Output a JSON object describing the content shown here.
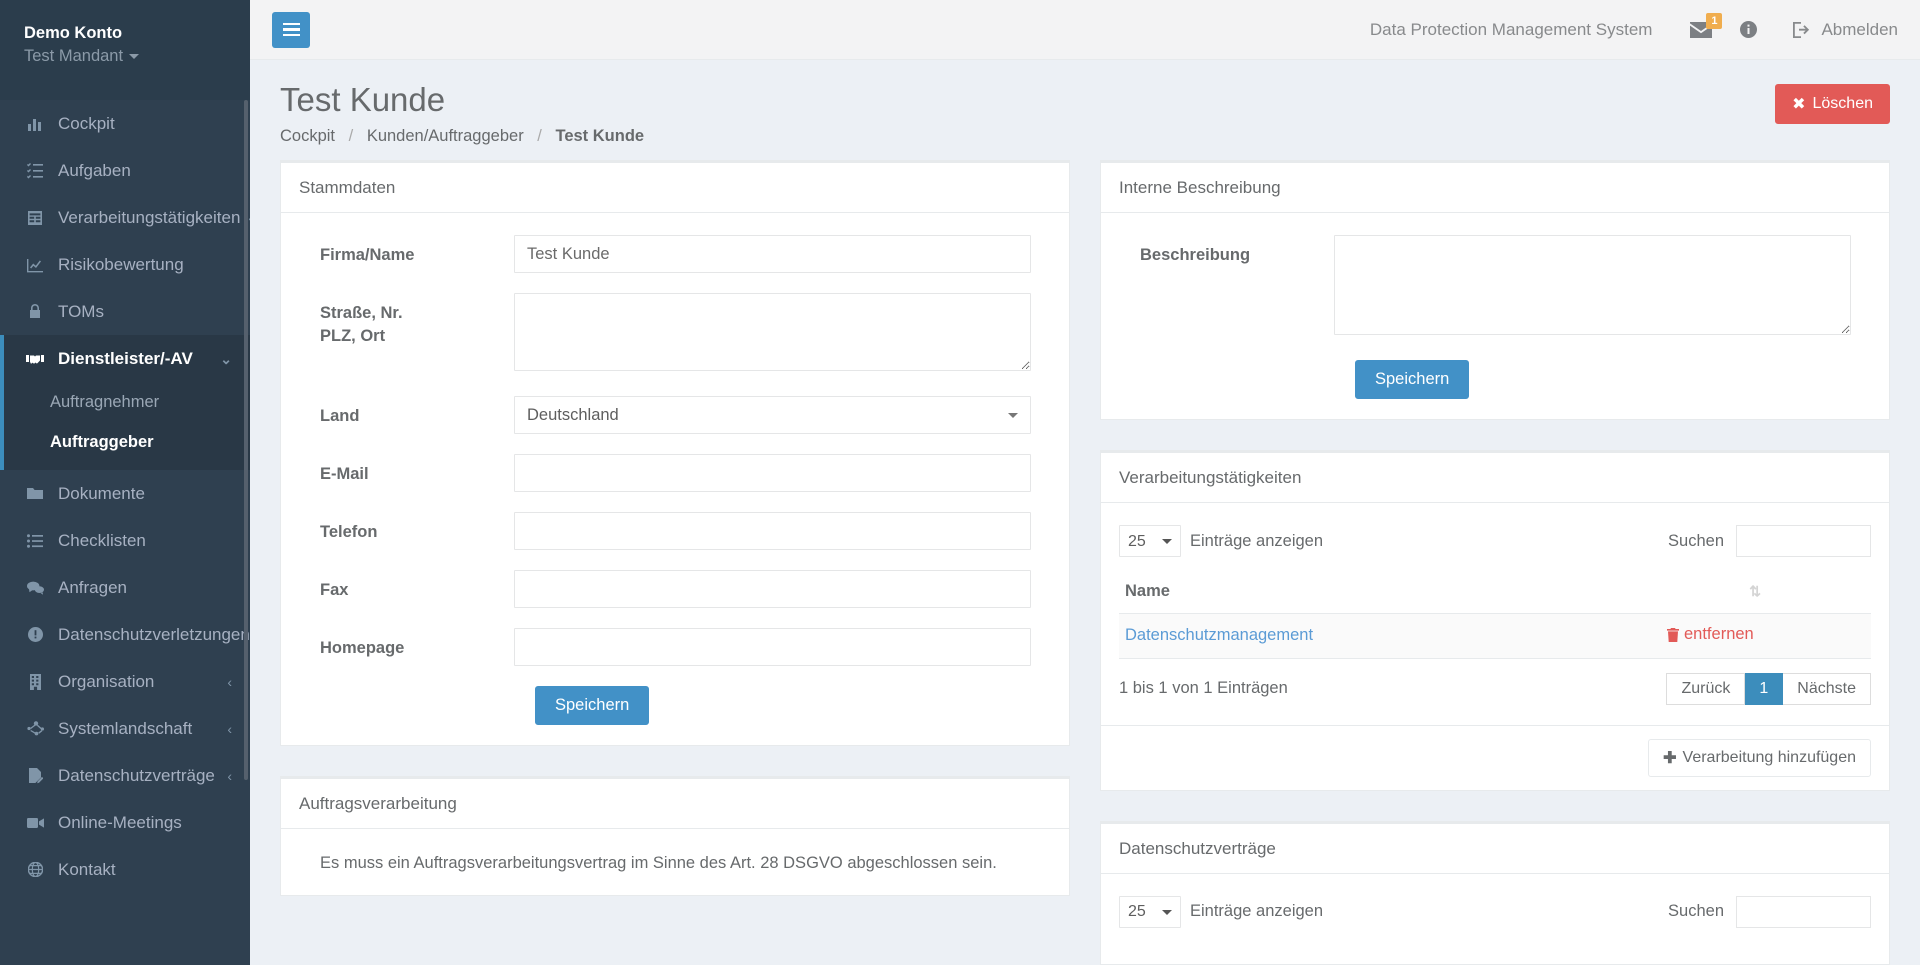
{
  "sidebar": {
    "user": {
      "name": "Demo Konto",
      "tenant": "Test Mandant"
    },
    "items": [
      {
        "label": "Cockpit",
        "icon": "chart-bar-icon",
        "chevron": ""
      },
      {
        "label": "Aufgaben",
        "icon": "tasks-icon",
        "chevron": ""
      },
      {
        "label": "Verarbeitungstätigkeiten",
        "icon": "table-icon",
        "chevron": "‹"
      },
      {
        "label": "Risikobewertung",
        "icon": "line-chart-icon",
        "chevron": ""
      },
      {
        "label": "TOMs",
        "icon": "lock-icon",
        "chevron": ""
      },
      {
        "label": "Dienstleister/-AV",
        "icon": "handshake-icon",
        "chevron": "⌄",
        "active": true,
        "children": [
          {
            "label": "Auftragnehmer",
            "active": false
          },
          {
            "label": "Auftraggeber",
            "active": true
          }
        ]
      },
      {
        "label": "Dokumente",
        "icon": "folder-icon",
        "chevron": ""
      },
      {
        "label": "Checklisten",
        "icon": "list-icon",
        "chevron": ""
      },
      {
        "label": "Anfragen",
        "icon": "comments-icon",
        "chevron": ""
      },
      {
        "label": "Datenschutzverletzungen",
        "icon": "exclamation-circle-icon",
        "chevron": ""
      },
      {
        "label": "Organisation",
        "icon": "building-icon",
        "chevron": "‹"
      },
      {
        "label": "Systemlandschaft",
        "icon": "sitemap-icon",
        "chevron": "‹"
      },
      {
        "label": "Datenschutzverträge",
        "icon": "file-signature-icon",
        "chevron": "‹"
      },
      {
        "label": "Online-Meetings",
        "icon": "video-icon",
        "chevron": ""
      },
      {
        "label": "Kontakt",
        "icon": "globe-icon",
        "chevron": ""
      }
    ]
  },
  "topbar": {
    "menu_toggle": "hamburger-icon",
    "app_title": "Data Protection Management System",
    "messages_badge": "1",
    "logout_label": "Abmelden"
  },
  "page": {
    "title": "Test Kunde",
    "breadcrumb": {
      "home": "Cockpit",
      "section": "Kunden/Auftraggeber",
      "current": "Test Kunde"
    },
    "delete_label": "Löschen"
  },
  "stammdaten": {
    "title": "Stammdaten",
    "fields": {
      "firma_label": "Firma/Name",
      "firma_value": "Test Kunde",
      "adresse_label_line1": "Straße, Nr.",
      "adresse_label_line2": "PLZ, Ort",
      "adresse_value": "",
      "land_label": "Land",
      "land_value": "Deutschland",
      "email_label": "E-Mail",
      "email_value": "",
      "telefon_label": "Telefon",
      "telefon_value": "",
      "fax_label": "Fax",
      "fax_value": "",
      "homepage_label": "Homepage",
      "homepage_value": ""
    },
    "save_label": "Speichern"
  },
  "interne_beschreibung": {
    "title": "Interne Beschreibung",
    "label": "Beschreibung",
    "value": "",
    "save_label": "Speichern"
  },
  "verarbeitungstaetigkeiten": {
    "title": "Verarbeitungstätigkeiten",
    "length_value": "25",
    "length_label": "Einträge anzeigen",
    "search_label": "Suchen",
    "search_value": "",
    "columns": [
      "Name"
    ],
    "rows": [
      {
        "name": "Datenschutzmanagement",
        "action": "entfernen"
      }
    ],
    "info": "1 bis 1 von 1 Einträgen",
    "pager": {
      "prev": "Zurück",
      "current": "1",
      "next": "Nächste"
    },
    "add_label": "Verarbeitung hinzufügen"
  },
  "auftragsverarbeitung": {
    "title": "Auftragsverarbeitung",
    "note": "Es muss ein Auftragsverarbeitungsvertrag im Sinne des Art. 28 DSGVO abgeschlossen sein."
  },
  "datenschutzvertraege": {
    "title": "Datenschutzverträge",
    "length_value": "25",
    "length_label": "Einträge anzeigen",
    "search_label": "Suchen",
    "search_value": ""
  },
  "colors": {
    "sidebar_bg": "#2f4050",
    "sidebar_active": "#293846",
    "accent_blue": "#3c8dbc",
    "primary_button": "#4291c7",
    "danger_red": "#e25a57",
    "badge_orange": "#f0ad4e",
    "page_bg": "#ecf0f5"
  }
}
